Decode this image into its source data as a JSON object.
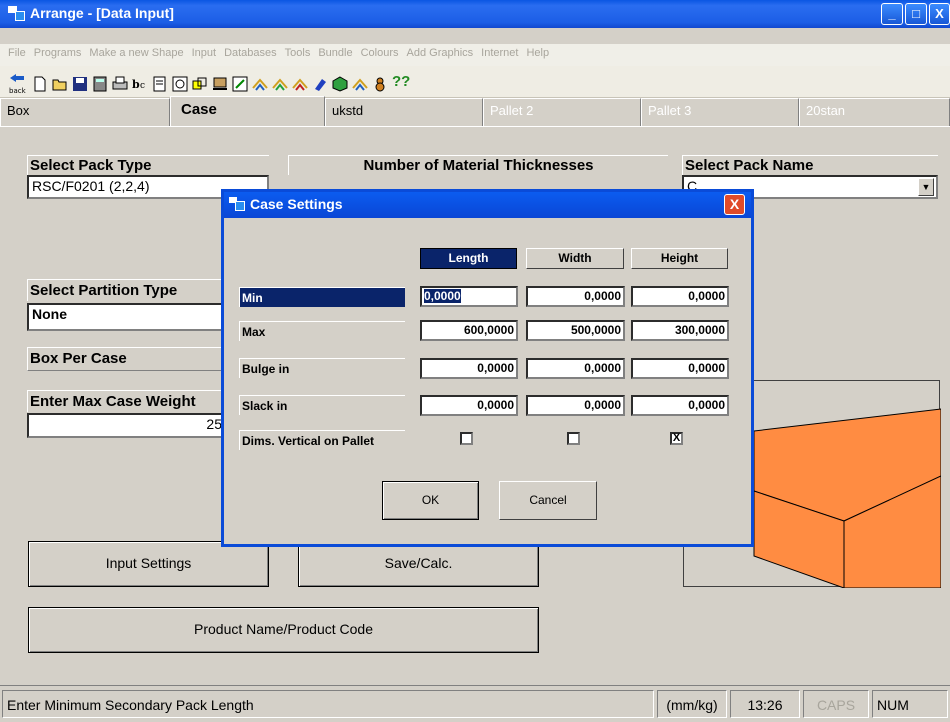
{
  "window": {
    "title": "Arrange - [Data Input]"
  },
  "menu": [
    "File",
    "Programs",
    "Make a new Shape",
    "Input",
    "Databases",
    "Tools",
    "Bundle",
    "Colours",
    "Add Graphics",
    "Internet",
    "Help"
  ],
  "toolbar": {
    "back_label": "back",
    "help_label": "??"
  },
  "tabs": [
    {
      "label": "Box",
      "state": "normal"
    },
    {
      "label": "Case",
      "state": "active"
    },
    {
      "label": "ukstd",
      "state": "normal"
    },
    {
      "label": "Pallet 2",
      "state": "disabled"
    },
    {
      "label": "Pallet 3",
      "state": "disabled"
    },
    {
      "label": "20stan",
      "state": "disabled"
    }
  ],
  "panel": {
    "pack_type_label": "Select Pack Type",
    "pack_type_value": "RSC/F0201 (2,2,4)",
    "thickness_label": "Number of Material Thicknesses",
    "pack_name_label": "Select Pack Name",
    "pack_name_value": "C",
    "partition_label": "Select Partition Type",
    "partition_value": "None",
    "box_per_case_label": "Box Per Case",
    "max_weight_label": "Enter Max Case Weight",
    "max_weight_value": "25",
    "input_settings_btn": "Input Settings",
    "save_calc_btn": "Save/Calc.",
    "product_name_btn": "Product Name/Product Code"
  },
  "dialog": {
    "title": "Case Settings",
    "close_label": "X",
    "columns": [
      "Length",
      "Width",
      "Height"
    ],
    "rows": [
      {
        "label": "Min",
        "values": [
          "0,0000",
          "0,0000",
          "0,0000"
        ]
      },
      {
        "label": "Max",
        "values": [
          "600,0000",
          "500,0000",
          "300,0000"
        ]
      },
      {
        "label": "Bulge in",
        "values": [
          "0,0000",
          "0,0000",
          "0,0000"
        ]
      },
      {
        "label": "Slack in",
        "values": [
          "0,0000",
          "0,0000",
          "0,0000"
        ]
      }
    ],
    "vertical_label": "Dims. Vertical on Pallet",
    "vertical_checks": [
      "",
      "",
      "X"
    ],
    "ok_label": "OK",
    "cancel_label": "Cancel"
  },
  "status": {
    "message": "Enter Minimum Secondary Pack Length",
    "units": "(mm/kg)",
    "time": "13:26",
    "caps": "CAPS",
    "num": "NUM"
  },
  "colors": {
    "box_orange": "#ff8c42",
    "title_blue": "#0a56e3",
    "selection_navy": "#0a246a"
  }
}
